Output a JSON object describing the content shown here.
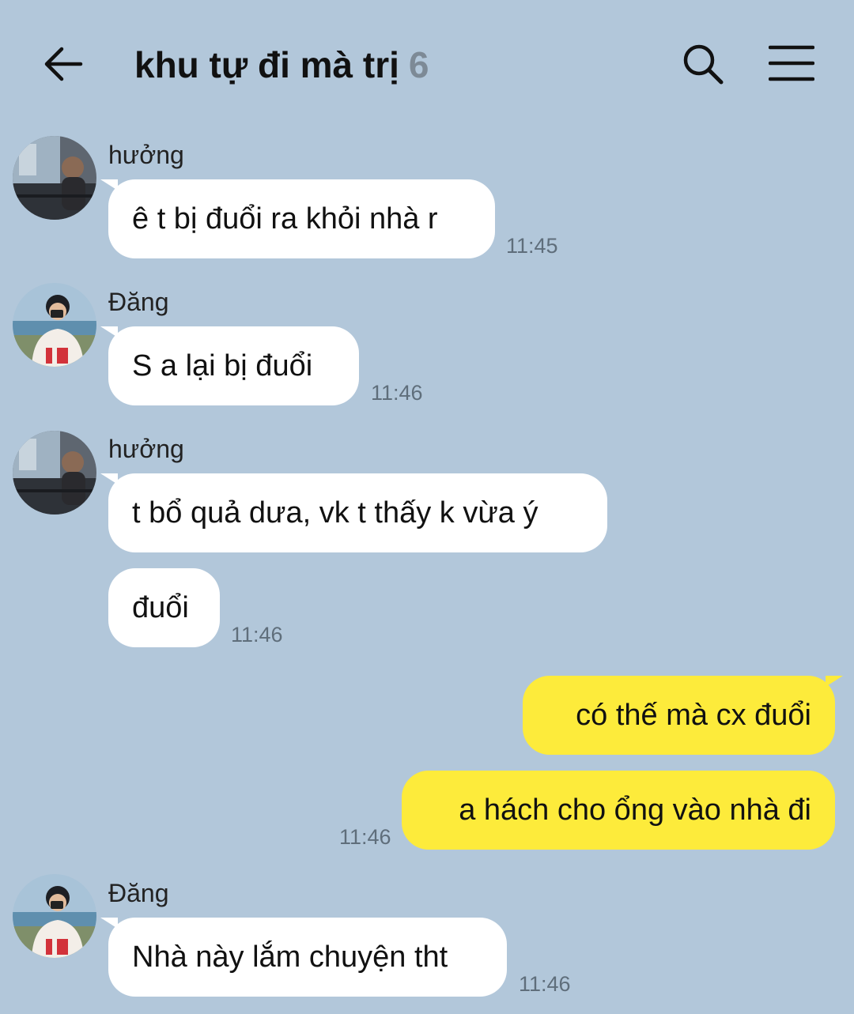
{
  "header": {
    "title": "khu tự đi mà trị",
    "member_count": "6"
  },
  "messages": [
    {
      "sender": "hưởng",
      "text": "ê t bị đuổi ra khỏi nhà r",
      "time": "11:45"
    },
    {
      "sender": "Đăng",
      "text": "S a lại bị đuổi",
      "time": "11:46"
    },
    {
      "sender": "hưởng",
      "text": "t bổ quả dưa, vk t thấy k vừa ý"
    },
    {
      "text": "đuổi",
      "time": "11:46"
    },
    {
      "text": "có thế mà cx đuổi"
    },
    {
      "text": "a hách cho ổng vào nhà đi",
      "time": "11:46"
    },
    {
      "sender": "Đăng",
      "text": "Nhà này lắm chuyện tht",
      "time": "11:46"
    }
  ],
  "colors": {
    "background": "#b2c7da",
    "incoming_bubble": "#ffffff",
    "outgoing_bubble": "#fdeb3b",
    "timestamp": "#5f6e7b"
  }
}
